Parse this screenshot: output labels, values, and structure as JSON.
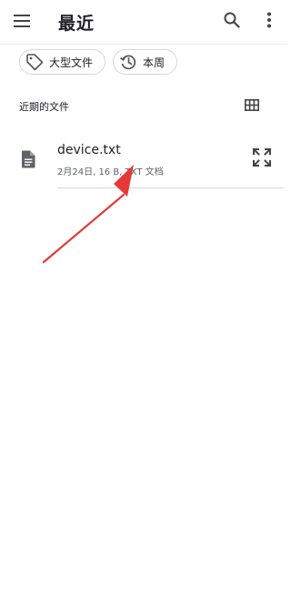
{
  "appbar": {
    "title": "最近",
    "menu_icon": "menu-icon",
    "search_icon": "search-icon",
    "more_icon": "more-vert-icon"
  },
  "chips": [
    {
      "label": "大型文件",
      "icon": "tag-icon"
    },
    {
      "label": "本周",
      "icon": "history-icon"
    }
  ],
  "section": {
    "title": "近期的文件",
    "view_toggle_icon": "grid-view-icon"
  },
  "files": [
    {
      "name": "device.txt",
      "meta": "2月24日, 16 B, TXT 文档",
      "icon": "document-icon",
      "action_icon": "expand-icon"
    }
  ],
  "annotation": {
    "type": "arrow",
    "color": "#e53935"
  }
}
